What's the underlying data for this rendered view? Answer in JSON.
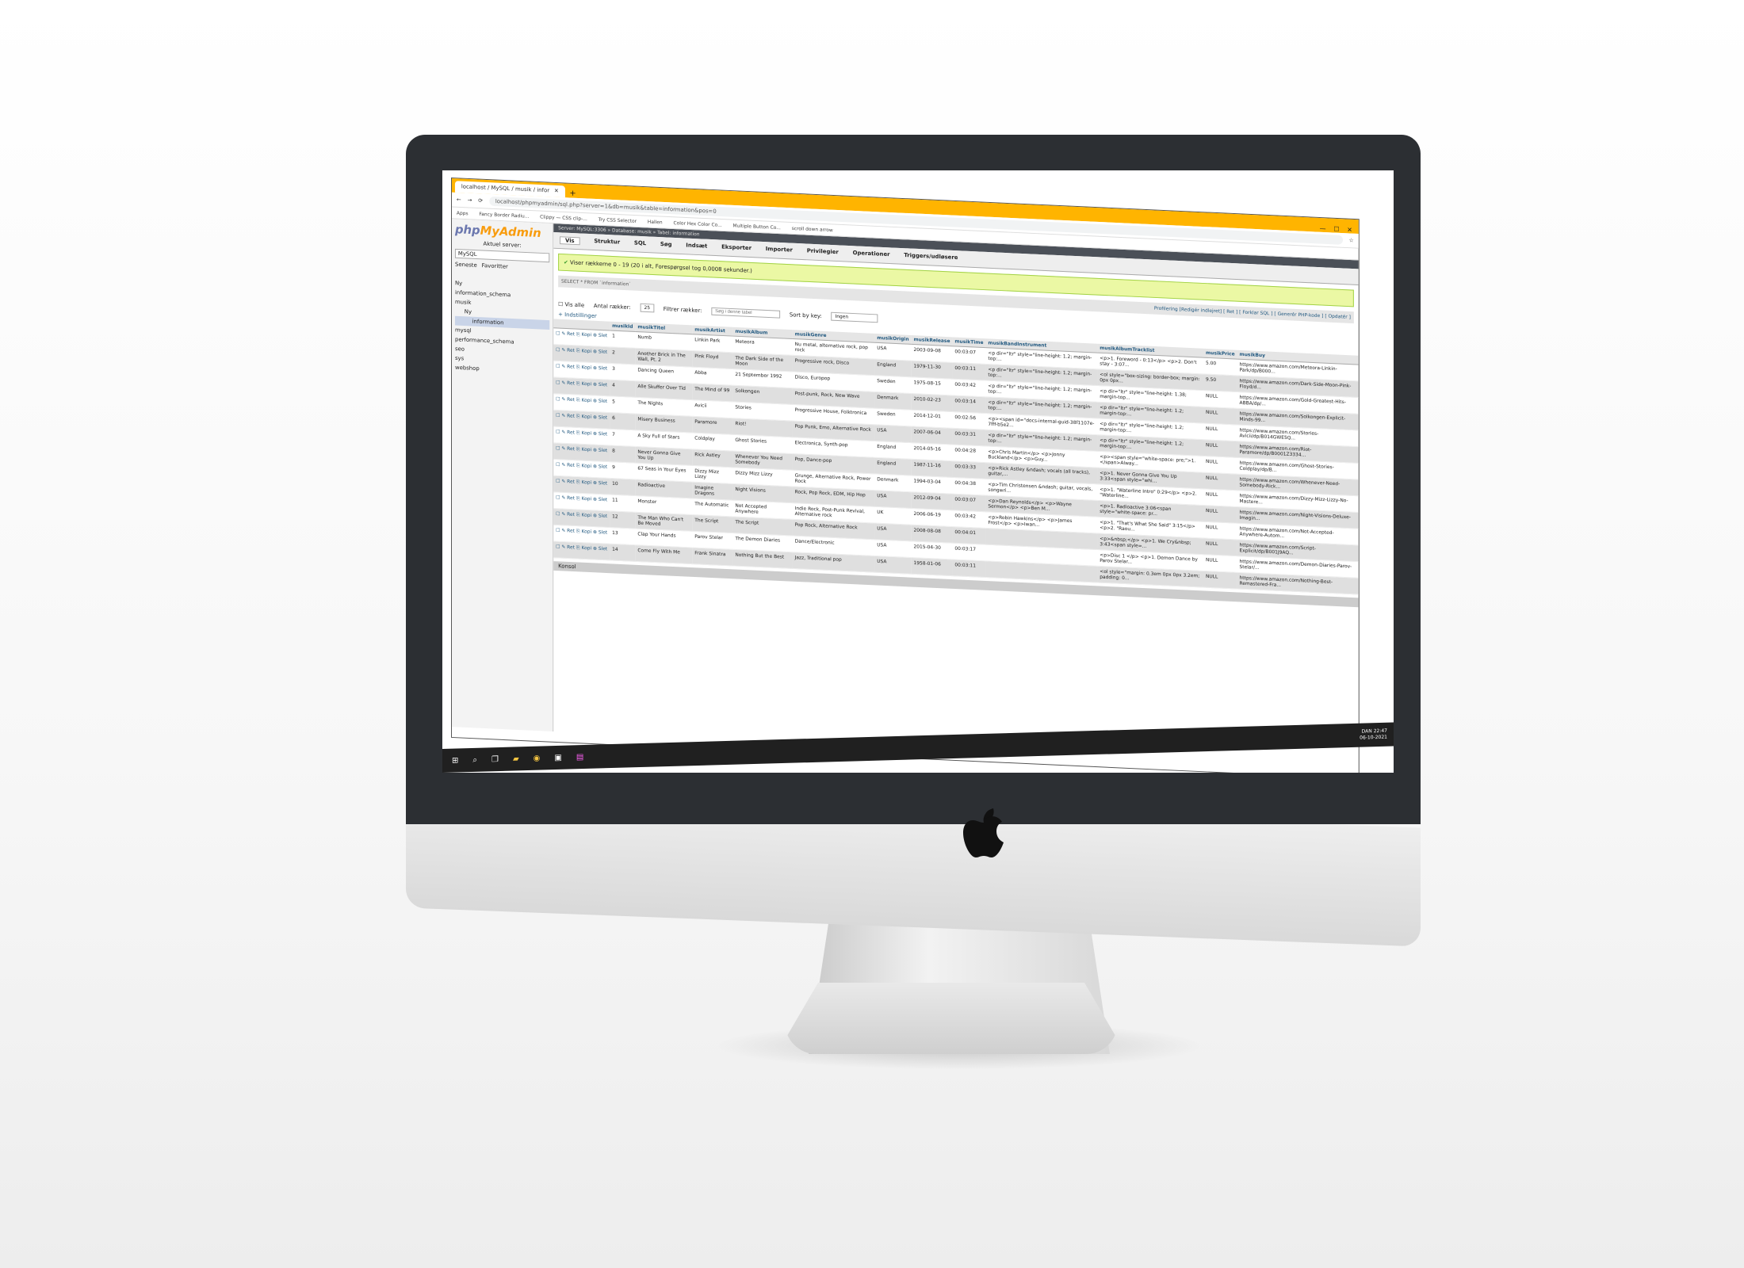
{
  "browser": {
    "tab_title": "localhost / MySQL / musik / infor",
    "address": "localhost/phpmyadmin/sql.php?server=1&db=musik&table=information&pos=0",
    "bookmarks": [
      "Apps",
      "Fancy Border Radiu...",
      "Clippy — CSS clip-...",
      "Try CSS Selector",
      "Hallen",
      "Color Hex Color Co...",
      "Multiple Button Co...",
      "scroll down arrow"
    ]
  },
  "sidebar": {
    "logo_php": "php",
    "logo_myadmin": "MyAdmin",
    "current_server_label": "Aktuel server:",
    "server_value": "MySQL",
    "links": [
      "Seneste",
      "Favoritter"
    ],
    "tree": [
      "Ny",
      "information_schema",
      "musik",
      "Ny",
      "information",
      "mysql",
      "performance_schema",
      "seo",
      "sys",
      "webshop"
    ]
  },
  "breadcrumb": "Server: MySQL:3306 » Database: musik » Tabel: information",
  "menu": [
    "Vis",
    "Struktur",
    "SQL",
    "Søg",
    "Indsæt",
    "Eksporter",
    "Importer",
    "Privilegier",
    "Operationer",
    "Triggers/udløsere"
  ],
  "success_message": "Viser rækkerne 0 - 19 (20 i alt, Forespørgsel tog 0,0008 sekunder.)",
  "sql_query": "SELECT * FROM `information`",
  "profiling": "Profilering [Redigér indlejret] [ Ret ] [ Forklar SQL ] [ Generér PHP-kode ] [ Opdatér ]",
  "controls": {
    "show_all": "Vis alle",
    "rows_label": "Antal rækker:",
    "rows_value": "25",
    "filter_label": "Filtrer rækker:",
    "filter_placeholder": "Søg i denne tabel",
    "sort_label": "Sort by key:",
    "sort_value": "Ingen",
    "options": "+ Indstillinger"
  },
  "actions": {
    "edit": "Ret",
    "copy": "Kopi",
    "delete": "Slet"
  },
  "columns": [
    "musikId",
    "musikTitel",
    "musikArtist",
    "musikAlbum",
    "musikGenre",
    "musikOrigin",
    "musikRelease",
    "musikTime",
    "musikBandInstrument",
    "musikAlbumTracklist",
    "musikPrice",
    "musikBuy"
  ],
  "rows": [
    [
      "1",
      "Numb",
      "Linkin Park",
      "Meteora",
      "Nu metal, alternative rock, pop rock",
      "USA",
      "2003-09-08",
      "00:03:07",
      "<p dir=\"ltr\" style=\"line-height: 1.2; margin-top:...",
      "<p>1. Foreword - 0:13</p> <p>2. Don't stay - 3:07...",
      "5.00",
      "https://www.amazon.com/Meteora-Linkin-Park/dp/B000..."
    ],
    [
      "2",
      "Another Brick in The Wall, Pt. 2",
      "Pink Floyd",
      "The Dark Side of the Moon",
      "Progressive rock, Disco",
      "England",
      "1979-11-30",
      "00:03:11",
      "<p dir=\"ltr\" style=\"line-height: 1.2; margin-top:...",
      "<ol style=\"box-sizing: border-box; margin: 0px 0px...",
      "9.50",
      "https://www.amazon.com/Dark-Side-Moon-Pink-Floyd/d..."
    ],
    [
      "3",
      "Dancing Queen",
      "Abba",
      "21 September 1992",
      "Disco, Europop",
      "Sweden",
      "1975-08-15",
      "00:03:42",
      "<p dir=\"ltr\" style=\"line-height: 1.2; margin-top:...",
      "<p dir=\"ltr\" style=\"line-height: 1.38; margin-top...",
      "NULL",
      "https://www.amazon.com/Gold-Greatest-Hits-ABBA/dp/..."
    ],
    [
      "4",
      "Alle Skuffer Over Tid",
      "The Mind of 99",
      "Solkongen",
      "Post-punk, Rock, New Wave",
      "Denmark",
      "2010-02-23",
      "00:03:14",
      "<p dir=\"ltr\" style=\"line-height: 1.2; margin-top:...",
      "<p dir=\"ltr\" style=\"line-height: 1.2; margin-top:...",
      "NULL",
      "https://www.amazon.com/Solkongen-Explicit-Minds-99..."
    ],
    [
      "5",
      "The Nights",
      "Avicii",
      "Stories",
      "Progressive House, Folktronica",
      "Sweden",
      "2014-12-01",
      "00:02:56",
      "<p><span id=\"docs-internal-guid-38f1107e-7fff-b5e2...",
      "<p dir=\"ltr\" style=\"line-height: 1.2; margin-top:...",
      "NULL",
      "https://www.amazon.com/Stories-Avicii/dp/B014GWE5Q..."
    ],
    [
      "6",
      "Misery Business",
      "Paramore",
      "Riot!",
      "Pop Punk, Emo, Alternative Rock",
      "USA",
      "2007-06-04",
      "00:03:31",
      "<p dir=\"ltr\" style=\"line-height: 1.2; margin-top:...",
      "<p dir=\"ltr\" style=\"line-height: 1.2; margin-top:...",
      "NULL",
      "https://www.amazon.com/Riot-Paramore/dp/B0001Z3334..."
    ],
    [
      "7",
      "A Sky Full of Stars",
      "Coldplay",
      "Ghost Stories",
      "Electronica, Synth-pop",
      "England",
      "2014-05-16",
      "00:04:28",
      "<p>Chris Martin</p> <p>Jonny Buckland</p> <p>Guy...",
      "<p><span style=\"white-space: pre;\">1. </span>Alway...",
      "NULL",
      "https://www.amazon.com/Ghost-Stories-Coldplay/dp/B..."
    ],
    [
      "8",
      "Never Gonna Give You Up",
      "Rick Astley",
      "Whenever You Need Somebody",
      "Pop, Dance-pop",
      "England",
      "1987-11-16",
      "00:03:33",
      "<p>Rick Astley &ndash; vocals (all tracks), guitar,...",
      "<p>1. Never Gonna Give You Up 3:33<span style=\"whi...",
      "NULL",
      "https://www.amazon.com/Whenever-Need-Somebody-Rick..."
    ],
    [
      "9",
      "67 Seas in Your Eyes",
      "Dizzy Mizz Lizzy",
      "Dizzy Mizz Lizzy",
      "Grunge, Alternative Rock, Power Rock",
      "Denmark",
      "1994-03-04",
      "00:04:38",
      "<p>Tim Christensen &ndash; guitar, vocals, songwri...",
      "<p>1. \"Waterline Intro\" 0:29</p> <p>2. \"Waterline...",
      "NULL",
      "https://www.amazon.com/Dizzy-Mizz-Lizzy-No-Mastere..."
    ],
    [
      "10",
      "Radioactive",
      "Imagine Dragons",
      "Night Visions",
      "Rock, Pop Rock, EDM, Hip Hop",
      "USA",
      "2012-09-04",
      "00:03:07",
      "<p>Dan Reynolds</p> <p>Wayne Sermon</p> <p>Ben M...",
      "<p>1. Radioactive 3:06<span style=\"white-space: pr...",
      "NULL",
      "https://www.amazon.com/Night-Visions-Deluxe-Imagin..."
    ],
    [
      "11",
      "Monster",
      "The Automatic",
      "Not Accepted Anywhere",
      "Indie Rock, Post-Punk Revival, Alternative rock",
      "UK",
      "2006-06-19",
      "00:03:42",
      "<p>Robin Hawkins</p> <p>James Frost</p> <p>Iwan...",
      "<p>1. \"That's What She Said\" 3:15</p> <p>2. \"Raou...",
      "NULL",
      "https://www.amazon.com/Not-Accepted-Anywhere-Autom..."
    ],
    [
      "12",
      "The Man Who Can't Be Moved",
      "The Script",
      "The Script",
      "Pop Rock, Alternative Rock",
      "USA",
      "2008-08-08",
      "00:04:01",
      "",
      "<p>&nbsp;</p> <p>1. We Cry&nbsp; 3:43<span style=...",
      "NULL",
      "https://www.amazon.com/Script-Explicit/dp/B001J9AQ..."
    ],
    [
      "13",
      "Clap Your Hands",
      "Parov Stelar",
      "The Demon Diaries",
      "Dance/Electronic",
      "USA",
      "2015-04-30",
      "00:03:17",
      "",
      "<p>Disc 1 </p> <p>1. Demon Dance by Parov Stelar...",
      "NULL",
      "https://www.amazon.com/Demon-Diaries-Parov-Stelar/..."
    ],
    [
      "14",
      "Come Fly With Me",
      "Frank Sinatra",
      "Nothing But the Best",
      "Jazz, Traditional pop",
      "USA",
      "1958-01-06",
      "00:03:11",
      "",
      "<ol style=\"margin: 0.3em 0px 0px 3.2em; padding: 0...",
      "NULL",
      "https://www.amazon.com/Nothing-Best-Remastered-Fra..."
    ]
  ],
  "console": "Konsol",
  "taskbar": {
    "lang": "DAN",
    "time": "22:47",
    "date": "06-10-2021"
  }
}
